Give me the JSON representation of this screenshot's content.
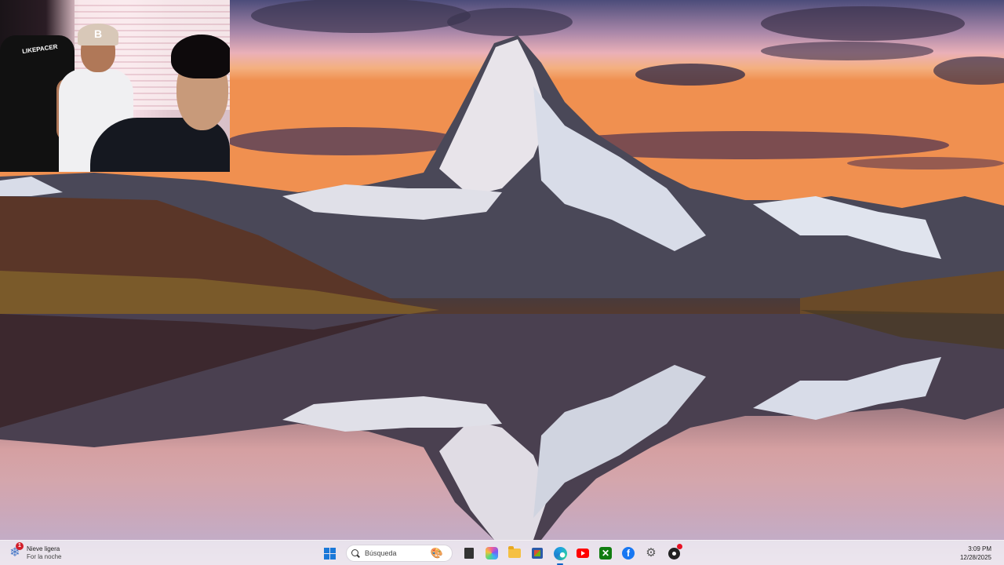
{
  "webcam": {
    "chair_text": "LIKEPACER",
    "cap_letter": "B"
  },
  "taskbar": {
    "weather": {
      "title": "Nieve ligera",
      "subtitle": "For la noche",
      "badge": "1",
      "icon": "snowflake-icon"
    },
    "search": {
      "placeholder": "Búsqueda"
    },
    "apps": [
      {
        "name": "start-button",
        "icon": "windows-icon"
      },
      {
        "name": "file-explorer-button",
        "icon": "file-icon"
      },
      {
        "name": "copilot-button",
        "icon": "copilot-icon"
      },
      {
        "name": "folder-button",
        "icon": "folder-icon"
      },
      {
        "name": "store-button",
        "icon": "store-icon"
      },
      {
        "name": "edge-button",
        "icon": "edge-icon"
      },
      {
        "name": "youtube-button",
        "icon": "youtube-icon"
      },
      {
        "name": "xbox-button",
        "icon": "xbox-icon"
      },
      {
        "name": "facebook-button",
        "icon": "facebook-icon"
      },
      {
        "name": "settings-button",
        "icon": "gear-icon"
      },
      {
        "name": "misc-app-button",
        "icon": "app-icon"
      }
    ],
    "clock": {
      "time": "3:09 PM",
      "date": "12/28/2025"
    },
    "colors": {
      "accent": "#1a78d8",
      "taskbar_bg": "#eee8f0"
    }
  }
}
